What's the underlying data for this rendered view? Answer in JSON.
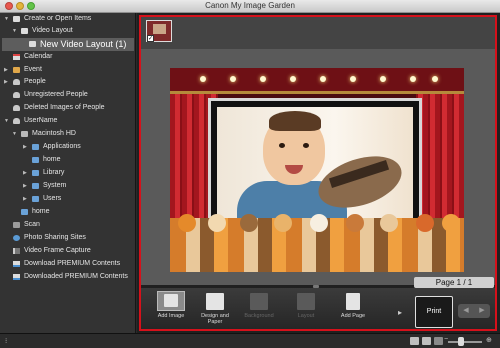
{
  "window": {
    "title": "Canon My Image Garden"
  },
  "sidebar": {
    "items": [
      {
        "label": "Create or Open Items",
        "icon": "document-icon"
      },
      {
        "label": "Video Layout",
        "icon": "document-icon"
      },
      {
        "label": "New Video Layout (1)",
        "icon": "document-icon"
      },
      {
        "label": "Calendar",
        "icon": "calendar-icon"
      },
      {
        "label": "Event",
        "icon": "event-icon"
      },
      {
        "label": "People",
        "icon": "person-icon"
      },
      {
        "label": "Unregistered People",
        "icon": "person-icon"
      },
      {
        "label": "Deleted Images of People",
        "icon": "person-icon"
      },
      {
        "label": "UserName",
        "icon": "person-icon"
      },
      {
        "label": "Macintosh HD",
        "icon": "disk-icon"
      },
      {
        "label": "Applications",
        "icon": "folder-icon"
      },
      {
        "label": "home",
        "icon": "folder-icon"
      },
      {
        "label": "Library",
        "icon": "folder-icon"
      },
      {
        "label": "System",
        "icon": "folder-icon"
      },
      {
        "label": "Users",
        "icon": "folder-icon"
      },
      {
        "label": "home",
        "icon": "folder-icon"
      },
      {
        "label": "Scan",
        "icon": "scan-icon"
      },
      {
        "label": "Photo Sharing Sites",
        "icon": "globe-icon"
      },
      {
        "label": "Video Frame Capture",
        "icon": "film-icon"
      },
      {
        "label": "Download PREMIUM Contents",
        "icon": "download-icon"
      },
      {
        "label": "Downloaded PREMIUM Contents",
        "icon": "download-icon"
      }
    ]
  },
  "preview": {
    "page_indicator": "Page 1 / 1"
  },
  "toolbar": {
    "add_image": "Add Image",
    "design_and_paper": "Design and\nPaper",
    "background": "Background",
    "layout": "Layout",
    "add_page": "Add Page",
    "print": "Print"
  },
  "colors": {
    "highlight_frame": "#d6111b",
    "curtain": "#d12b32",
    "selected_row": "#5d5d5d"
  }
}
